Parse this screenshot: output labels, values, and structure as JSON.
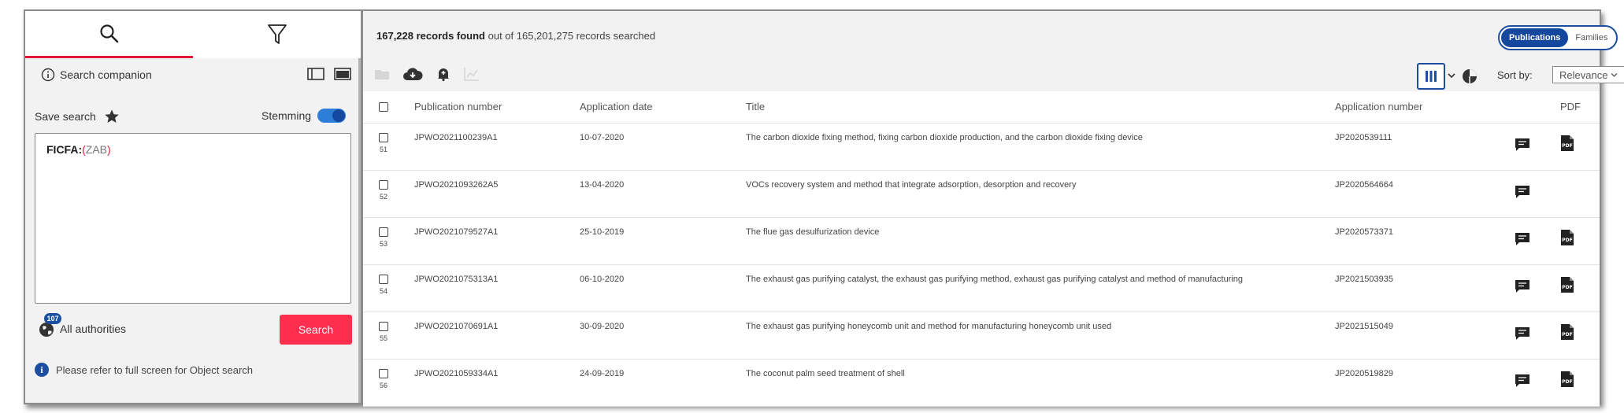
{
  "left_panel": {
    "tabs": [
      {
        "icon": "search-icon",
        "active": true
      },
      {
        "icon": "filter-icon",
        "active": false
      }
    ],
    "search_companion_label": "Search companion",
    "save_search_label": "Save search",
    "stemming_label": "Stemming",
    "stemming_on": true,
    "query": {
      "key": "FICFA:",
      "open_paren": "(",
      "value": "ZAB",
      "close_paren": ")"
    },
    "authorities_count": "107",
    "authorities_label": "All authorities",
    "search_button_label": "Search",
    "info_note": "Please refer to full screen for Object search",
    "accent_color": "#e31837",
    "brand_color": "#1c4fa0"
  },
  "results": {
    "count_bold": "167,228 records found",
    "count_rest": " out of 165,201,275 records searched",
    "view_toggle": {
      "active": "Publications",
      "inactive": "Families"
    },
    "sort_label": "Sort by:",
    "sort_value": "Relevance",
    "columns": {
      "publication_number": "Publication number",
      "application_date": "Application date",
      "title": "Title",
      "application_number": "Application number",
      "pdf": "PDF"
    },
    "rows": [
      {
        "num": "51",
        "pub": "JPWO2021100239A1",
        "date": "10-07-2020",
        "title": "The carbon dioxide fixing method, fixing carbon dioxide production, and the carbon dioxide fixing device",
        "app": "JP2020539111",
        "has_pdf": true
      },
      {
        "num": "52",
        "pub": "JPWO2021093262A5",
        "date": "13-04-2020",
        "title": "VOCs recovery system and method that integrate adsorption, desorption and recovery",
        "app": "JP2020564664",
        "has_pdf": false
      },
      {
        "num": "53",
        "pub": "JPWO2021079527A1",
        "date": "25-10-2019",
        "title": "The flue gas desulfurization device",
        "app": "JP2020573371",
        "has_pdf": true
      },
      {
        "num": "54",
        "pub": "JPWO2021075313A1",
        "date": "06-10-2020",
        "title": "The exhaust gas purifying catalyst, the exhaust gas purifying method, exhaust gas purifying catalyst and method of manufacturing",
        "app": "JP2021503935",
        "has_pdf": true
      },
      {
        "num": "55",
        "pub": "JPWO2021070691A1",
        "date": "30-09-2020",
        "title": "The exhaust gas purifying honeycomb unit and method for manufacturing honeycomb unit used",
        "app": "JP2021515049",
        "has_pdf": true
      },
      {
        "num": "56",
        "pub": "JPWO2021059334A1",
        "date": "24-09-2019",
        "title": "The coconut palm seed treatment of shell",
        "app": "JP2020519829",
        "has_pdf": true
      }
    ]
  }
}
